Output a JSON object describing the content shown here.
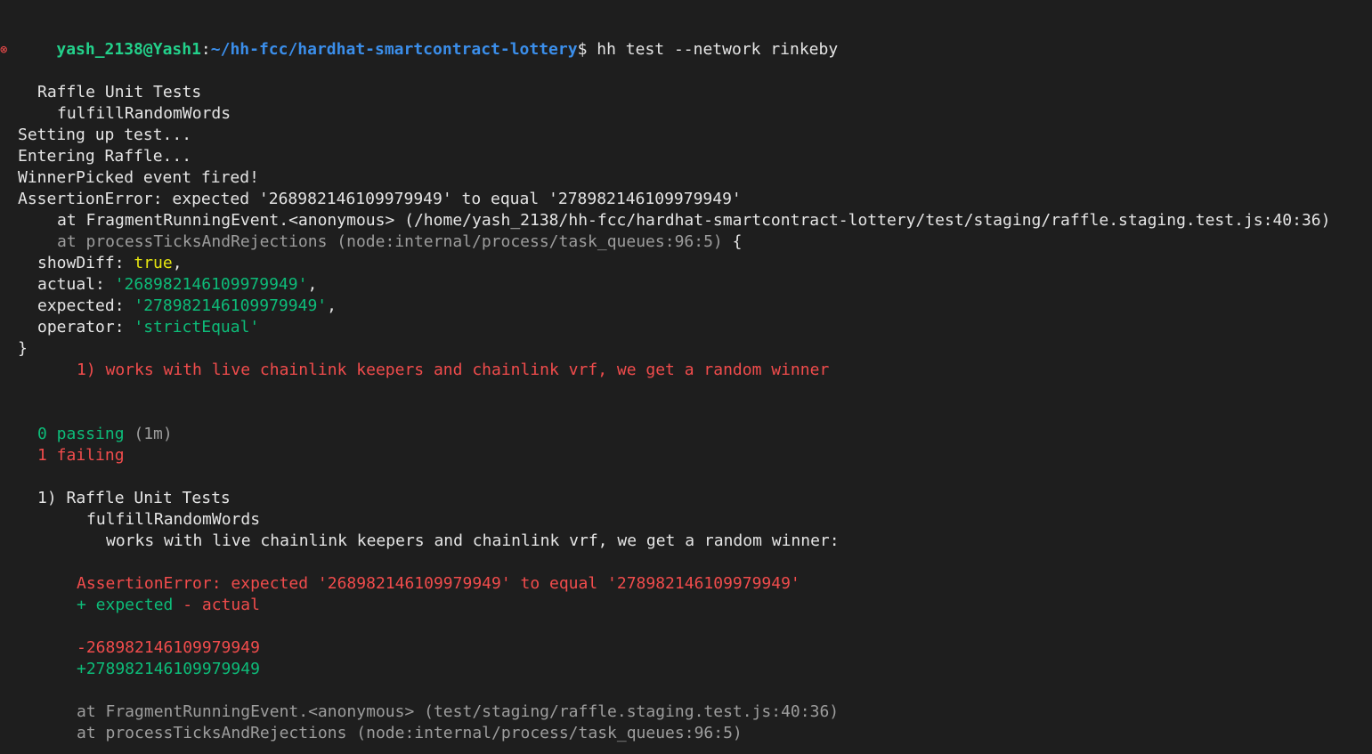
{
  "prompt": {
    "user_host": "yash_2138@Yash1",
    "sep": ":",
    "path": "~/hh-fcc/hardhat-smartcontract-lottery",
    "dollar": "$",
    "command": " hh test --network rinkeby",
    "fail_icon": "⊗"
  },
  "output": {
    "suite": "Raffle Unit Tests",
    "describe": "fulfillRandomWords",
    "log1": "Setting up test...",
    "log2": "Entering Raffle...",
    "log3": "WinnerPicked event fired!",
    "assertion": "AssertionError: expected '268982146109979949' to equal '278982146109979949'",
    "stack1": "at FragmentRunningEvent.<anonymous> (/home/yash_2138/hh-fcc/hardhat-smartcontract-lottery/test/staging/raffle.staging.test.js:40:36)",
    "stack2": "at processTicksAndRejections (node:internal/process/task_queues:96:5)",
    "brace_open": " {",
    "showdiff_key": "showDiff: ",
    "showdiff_val": "true",
    "actual_key": "actual: ",
    "actual_val": "'268982146109979949'",
    "expected_key": "expected: ",
    "expected_val": "'278982146109979949'",
    "operator_key": "operator: ",
    "operator_val": "'strictEqual'",
    "comma": ",",
    "brace_close": "}",
    "failed_test": "1) works with live chainlink keepers and chainlink vrf, we get a random winner"
  },
  "summary": {
    "passing": "0 passing",
    "passing_time": " (1m)",
    "failing": "1 failing"
  },
  "failure_detail": {
    "title": "1) Raffle Unit Tests",
    "describe": "fulfillRandomWords",
    "test": "works with live chainlink keepers and chainlink vrf, we get a random winner:",
    "assertion": "AssertionError: expected '268982146109979949' to equal '278982146109979949'",
    "legend_plus": "+ expected",
    "legend_minus": " - actual",
    "minus_line": "-268982146109979949",
    "plus_line": "+278982146109979949",
    "stack1": "at FragmentRunningEvent.<anonymous> (test/staging/raffle.staging.test.js:40:36)",
    "stack2": "at processTicksAndRejections (node:internal/process/task_queues:96:5)"
  }
}
